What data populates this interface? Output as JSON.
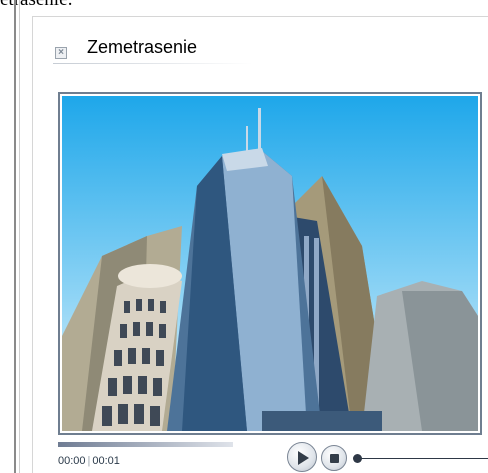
{
  "header_fragment": "etrasenie:",
  "widget": {
    "title": "Zemetrasenie",
    "icon": "close-x-icon"
  },
  "player": {
    "current_time": "00:00",
    "separator": "|",
    "duration": "00:01",
    "progress_fraction": 0.0,
    "volume_fraction": 0.0,
    "play_icon": "play-icon",
    "stop_icon": "stop-icon"
  },
  "colors": {
    "frame_border": "#6f7e90",
    "sky_top": "#1ea7ea",
    "sky_bottom": "#e9f7fd",
    "control_dark": "#333d49"
  }
}
